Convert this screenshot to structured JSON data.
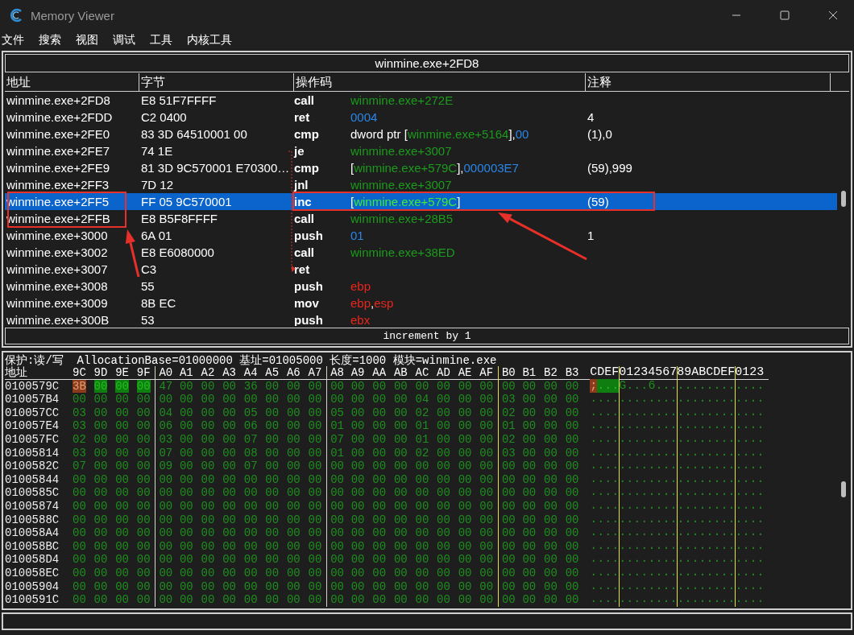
{
  "window": {
    "title": "Memory Viewer"
  },
  "menu": [
    "文件",
    "搜索",
    "视图",
    "调试",
    "工具",
    "内核工具"
  ],
  "disassembly": {
    "location": "winmine.exe+2FD8",
    "columns": [
      "地址",
      "字节",
      "操作码",
      "注释"
    ],
    "rows": [
      {
        "address": "winmine.exe+2FD8",
        "bytes": "E8 51F7FFFF",
        "opcode": "call",
        "operand": [
          {
            "text": "winmine.exe+272E",
            "kind": "symbol"
          }
        ],
        "selected": false
      },
      {
        "address": "winmine.exe+2FDD",
        "bytes": "C2 0400",
        "opcode": "ret",
        "operand": [
          {
            "text": "0004",
            "kind": "number"
          }
        ],
        "comment": "4",
        "selected": false
      },
      {
        "address": "winmine.exe+2FE0",
        "bytes": "83 3D 64510001 00",
        "opcode": "cmp",
        "operand": [
          {
            "text": "dword ptr [",
            "kind": "plain"
          },
          {
            "text": "winmine.exe+5164",
            "kind": "symbol"
          },
          {
            "text": "],",
            "kind": "plain"
          },
          {
            "text": "00",
            "kind": "number"
          }
        ],
        "comment": "(1),0",
        "selected": false
      },
      {
        "address": "winmine.exe+2FE7",
        "bytes": "74 1E",
        "opcode": "je",
        "operand": [
          {
            "text": "winmine.exe+3007",
            "kind": "symbol"
          }
        ],
        "selected": false
      },
      {
        "address": "winmine.exe+2FE9",
        "bytes": "81 3D 9C570001 E70300…",
        "opcode": "cmp",
        "operand": [
          {
            "text": "[",
            "kind": "plain"
          },
          {
            "text": "winmine.exe+579C",
            "kind": "symbol"
          },
          {
            "text": "],",
            "kind": "plain"
          },
          {
            "text": "000003E7",
            "kind": "number"
          }
        ],
        "comment": "(59),999",
        "selected": false
      },
      {
        "address": "winmine.exe+2FF3",
        "bytes": "7D 12",
        "opcode": "jnl",
        "operand": [
          {
            "text": "winmine.exe+3007",
            "kind": "symbol"
          }
        ],
        "selected": false
      },
      {
        "address": "winmine.exe+2FF5",
        "bytes": "FF 05 9C570001",
        "opcode": "inc",
        "operand": [
          {
            "text": "[",
            "kind": "plain"
          },
          {
            "text": "winmine.exe+579C",
            "kind": "symbol"
          },
          {
            "text": "]",
            "kind": "plain"
          }
        ],
        "comment": "(59)",
        "selected": true
      },
      {
        "address": "winmine.exe+2FFB",
        "bytes": "E8 B5F8FFFF",
        "opcode": "call",
        "operand": [
          {
            "text": "winmine.exe+28B5",
            "kind": "symbol"
          }
        ],
        "selected": false
      },
      {
        "address": "winmine.exe+3000",
        "bytes": "6A 01",
        "opcode": "push",
        "operand": [
          {
            "text": "01",
            "kind": "number"
          }
        ],
        "comment": "1",
        "selected": false
      },
      {
        "address": "winmine.exe+3002",
        "bytes": "E8 E6080000",
        "opcode": "call",
        "operand": [
          {
            "text": "winmine.exe+38ED",
            "kind": "symbol"
          }
        ],
        "selected": false
      },
      {
        "address": "winmine.exe+3007",
        "bytes": "C3",
        "opcode": "ret",
        "operand": [],
        "selected": false
      },
      {
        "address": "winmine.exe+3008",
        "bytes": "55",
        "opcode": "push",
        "operand": [
          {
            "text": "ebp",
            "kind": "register"
          }
        ],
        "selected": false
      },
      {
        "address": "winmine.exe+3009",
        "bytes": "8B EC",
        "opcode": "mov",
        "operand": [
          {
            "text": "ebp",
            "kind": "register"
          },
          {
            "text": ",",
            "kind": "plain"
          },
          {
            "text": "esp",
            "kind": "register"
          }
        ],
        "selected": false
      },
      {
        "address": "winmine.exe+300B",
        "bytes": "53",
        "opcode": "push",
        "operand": [
          {
            "text": "ebx",
            "kind": "register"
          }
        ],
        "selected": false
      }
    ],
    "annotations": [
      {
        "kind": "box"
      },
      {
        "kind": "box"
      },
      {
        "kind": "arrow"
      },
      {
        "kind": "arrow"
      }
    ],
    "hint": "increment by 1"
  },
  "hex": {
    "info": "保护:读/写  AllocationBase=01000000 基址=01005000 长度=1000 模块=winmine.exe",
    "address_label": "地址",
    "columns": [
      "9C",
      "9D",
      "9E",
      "9F",
      "A0",
      "A1",
      "A2",
      "A3",
      "A4",
      "A5",
      "A6",
      "A7",
      "A8",
      "A9",
      "AA",
      "AB",
      "AC",
      "AD",
      "AE",
      "AF",
      "B0",
      "B1",
      "B2",
      "B3"
    ],
    "ascii_header": "CDEF0123456789ABCDEF0123",
    "rows": [
      {
        "address": "0100579C",
        "bytes": [
          "3B",
          "00",
          "00",
          "00",
          "47",
          "00",
          "00",
          "00",
          "36",
          "00",
          "00",
          "00",
          "00",
          "00",
          "00",
          "00",
          "00",
          "00",
          "00",
          "00",
          "00",
          "00",
          "00",
          "00"
        ],
        "ascii": ";...G...6...............",
        "highlights": [
          {
            "kind": "changed"
          },
          {
            "kind": "selected"
          },
          {
            "kind": "selected"
          },
          {
            "kind": "selected"
          }
        ]
      },
      {
        "address": "010057B4",
        "bytes": [
          "00",
          "00",
          "00",
          "00",
          "00",
          "00",
          "00",
          "00",
          "00",
          "00",
          "00",
          "00",
          "00",
          "00",
          "00",
          "00",
          "04",
          "00",
          "00",
          "00",
          "03",
          "00",
          "00",
          "00"
        ],
        "ascii": "........................"
      },
      {
        "address": "010057CC",
        "bytes": [
          "03",
          "00",
          "00",
          "00",
          "04",
          "00",
          "00",
          "00",
          "05",
          "00",
          "00",
          "00",
          "05",
          "00",
          "00",
          "00",
          "02",
          "00",
          "00",
          "00",
          "02",
          "00",
          "00",
          "00"
        ],
        "ascii": "........................"
      },
      {
        "address": "010057E4",
        "bytes": [
          "03",
          "00",
          "00",
          "00",
          "06",
          "00",
          "00",
          "00",
          "06",
          "00",
          "00",
          "00",
          "01",
          "00",
          "00",
          "00",
          "01",
          "00",
          "00",
          "00",
          "01",
          "00",
          "00",
          "00"
        ],
        "ascii": "........................"
      },
      {
        "address": "010057FC",
        "bytes": [
          "02",
          "00",
          "00",
          "00",
          "03",
          "00",
          "00",
          "00",
          "07",
          "00",
          "00",
          "00",
          "07",
          "00",
          "00",
          "00",
          "01",
          "00",
          "00",
          "00",
          "02",
          "00",
          "00",
          "00"
        ],
        "ascii": "........................"
      },
      {
        "address": "01005814",
        "bytes": [
          "03",
          "00",
          "00",
          "00",
          "07",
          "00",
          "00",
          "00",
          "08",
          "00",
          "00",
          "00",
          "01",
          "00",
          "00",
          "00",
          "02",
          "00",
          "00",
          "00",
          "03",
          "00",
          "00",
          "00"
        ],
        "ascii": "........................"
      },
      {
        "address": "0100582C",
        "bytes": [
          "07",
          "00",
          "00",
          "00",
          "09",
          "00",
          "00",
          "00",
          "07",
          "00",
          "00",
          "00",
          "00",
          "00",
          "00",
          "00",
          "00",
          "00",
          "00",
          "00",
          "00",
          "00",
          "00",
          "00"
        ],
        "ascii": "........................"
      },
      {
        "address": "01005844",
        "bytes": [
          "00",
          "00",
          "00",
          "00",
          "00",
          "00",
          "00",
          "00",
          "00",
          "00",
          "00",
          "00",
          "00",
          "00",
          "00",
          "00",
          "00",
          "00",
          "00",
          "00",
          "00",
          "00",
          "00",
          "00"
        ],
        "ascii": "........................"
      },
      {
        "address": "0100585C",
        "bytes": [
          "00",
          "00",
          "00",
          "00",
          "00",
          "00",
          "00",
          "00",
          "00",
          "00",
          "00",
          "00",
          "00",
          "00",
          "00",
          "00",
          "00",
          "00",
          "00",
          "00",
          "00",
          "00",
          "00",
          "00"
        ],
        "ascii": "........................"
      },
      {
        "address": "01005874",
        "bytes": [
          "00",
          "00",
          "00",
          "00",
          "00",
          "00",
          "00",
          "00",
          "00",
          "00",
          "00",
          "00",
          "00",
          "00",
          "00",
          "00",
          "00",
          "00",
          "00",
          "00",
          "00",
          "00",
          "00",
          "00"
        ],
        "ascii": "........................"
      },
      {
        "address": "0100588C",
        "bytes": [
          "00",
          "00",
          "00",
          "00",
          "00",
          "00",
          "00",
          "00",
          "00",
          "00",
          "00",
          "00",
          "00",
          "00",
          "00",
          "00",
          "00",
          "00",
          "00",
          "00",
          "00",
          "00",
          "00",
          "00"
        ],
        "ascii": "........................"
      },
      {
        "address": "010058A4",
        "bytes": [
          "00",
          "00",
          "00",
          "00",
          "00",
          "00",
          "00",
          "00",
          "00",
          "00",
          "00",
          "00",
          "00",
          "00",
          "00",
          "00",
          "00",
          "00",
          "00",
          "00",
          "00",
          "00",
          "00",
          "00"
        ],
        "ascii": "........................"
      },
      {
        "address": "010058BC",
        "bytes": [
          "00",
          "00",
          "00",
          "00",
          "00",
          "00",
          "00",
          "00",
          "00",
          "00",
          "00",
          "00",
          "00",
          "00",
          "00",
          "00",
          "00",
          "00",
          "00",
          "00",
          "00",
          "00",
          "00",
          "00"
        ],
        "ascii": "........................"
      },
      {
        "address": "010058D4",
        "bytes": [
          "00",
          "00",
          "00",
          "00",
          "00",
          "00",
          "00",
          "00",
          "00",
          "00",
          "00",
          "00",
          "00",
          "00",
          "00",
          "00",
          "00",
          "00",
          "00",
          "00",
          "00",
          "00",
          "00",
          "00"
        ],
        "ascii": "........................"
      },
      {
        "address": "010058EC",
        "bytes": [
          "00",
          "00",
          "00",
          "00",
          "00",
          "00",
          "00",
          "00",
          "00",
          "00",
          "00",
          "00",
          "00",
          "00",
          "00",
          "00",
          "00",
          "00",
          "00",
          "00",
          "00",
          "00",
          "00",
          "00"
        ],
        "ascii": "........................"
      },
      {
        "address": "01005904",
        "bytes": [
          "00",
          "00",
          "00",
          "00",
          "00",
          "00",
          "00",
          "00",
          "00",
          "00",
          "00",
          "00",
          "00",
          "00",
          "00",
          "00",
          "00",
          "00",
          "00",
          "00",
          "00",
          "00",
          "00",
          "00"
        ],
        "ascii": "........................"
      },
      {
        "address": "0100591C",
        "bytes": [
          "00",
          "00",
          "00",
          "00",
          "00",
          "00",
          "00",
          "00",
          "00",
          "00",
          "00",
          "00",
          "00",
          "00",
          "00",
          "00",
          "00",
          "00",
          "00",
          "00",
          "00",
          "00",
          "00",
          "00"
        ],
        "ascii": "........................"
      }
    ]
  }
}
